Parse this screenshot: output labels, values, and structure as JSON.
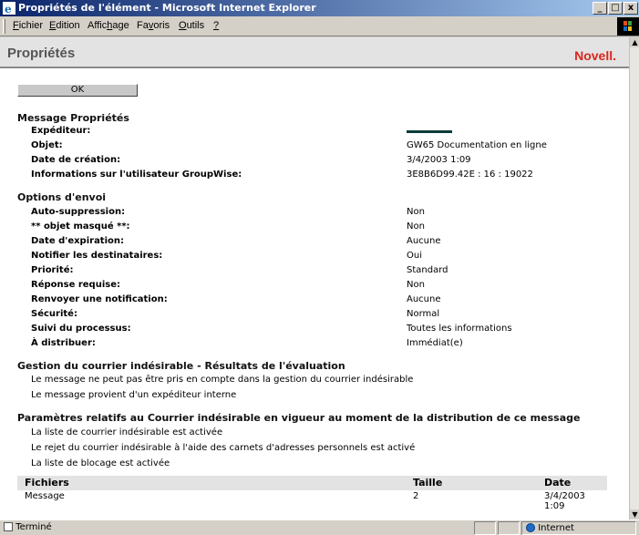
{
  "window": {
    "title": "Propriétés de l'élément - Microsoft Internet Explorer",
    "minimize": "_",
    "maximize": "□",
    "close": "x"
  },
  "menu": {
    "items": [
      {
        "ul": "F",
        "rest": "ichier"
      },
      {
        "ul": "E",
        "rest": "dition"
      },
      {
        "pre": "Affic",
        "ul": "h",
        "rest": "age"
      },
      {
        "pre": "Fa",
        "ul": "v",
        "rest": "oris"
      },
      {
        "ul": "O",
        "rest": "utils"
      },
      {
        "ul": "?",
        "rest": ""
      }
    ]
  },
  "header": {
    "title": "Propriétés",
    "brand": "Novell."
  },
  "ok_label": "OK",
  "message_props": {
    "title": "Message  Propriétés",
    "rows": [
      {
        "label": "Expéditeur:",
        "value": ""
      },
      {
        "label": "Objet:",
        "value": "GW65 Documentation en ligne"
      },
      {
        "label": "Date de création:",
        "value": "3/4/2003 1:09"
      },
      {
        "label": "Informations sur l'utilisateur GroupWise:",
        "value": "3E8B6D99.42E : 16 : 19022"
      }
    ]
  },
  "send_options": {
    "title": "Options d'envoi",
    "rows": [
      {
        "label": "Auto-suppression:",
        "value": "Non"
      },
      {
        "label": "** objet masqué **:",
        "value": "Non"
      },
      {
        "label": "Date d'expiration:",
        "value": "Aucune"
      },
      {
        "label": "Notifier les destinataires:",
        "value": "Oui"
      },
      {
        "label": "Priorité:",
        "value": "Standard"
      },
      {
        "label": "Réponse requise:",
        "value": "Non"
      },
      {
        "label": "Renvoyer une notification:",
        "value": "Aucune"
      },
      {
        "label": "Sécurité:",
        "value": "Normal"
      },
      {
        "label": "Suivi du processus:",
        "value": "Toutes les informations"
      },
      {
        "label": "À distribuer:",
        "value": "Immédiat(e)"
      }
    ]
  },
  "junk_eval": {
    "title": "Gestion du courrier indésirable - Résultats de l'évaluation",
    "lines": [
      "Le message ne peut pas être pris en compte dans la gestion du courrier indésirable",
      "Le message provient d'un expéditeur interne"
    ]
  },
  "junk_params": {
    "title": "Paramètres relatifs au Courrier indésirable en vigueur au moment de la distribution de ce message",
    "lines": [
      "La liste de courrier indésirable est activée",
      "Le rejet du courrier indésirable à l'aide des carnets d'adresses personnels est activé",
      "La liste de blocage est activée"
    ]
  },
  "files": {
    "headers": [
      "Fichiers",
      "Taille",
      "Date"
    ],
    "rows": [
      [
        "Message",
        "2",
        "3/4/2003 1:09"
      ]
    ]
  },
  "status": {
    "left": "Terminé",
    "zone": "Internet"
  }
}
